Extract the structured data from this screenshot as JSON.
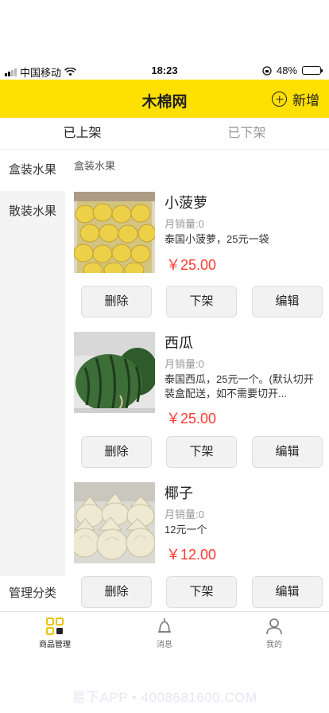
{
  "status_bar": {
    "carrier": "中国移动",
    "time": "18:23",
    "battery": "48%",
    "battery_level": 0.48
  },
  "header": {
    "title": "木棉网",
    "add_label": "新增"
  },
  "tabs": [
    {
      "label": "已上架",
      "active": true
    },
    {
      "label": "已下架",
      "active": false
    }
  ],
  "sidebar": {
    "categories": [
      {
        "label": "盒装水果"
      },
      {
        "label": "散装水果"
      }
    ],
    "manage_label": "管理分类"
  },
  "main": {
    "section_title": "盒装水果"
  },
  "products": [
    {
      "name": "小菠萝",
      "sales": "月销量:0",
      "desc": "泰国小菠萝，25元一袋",
      "price": "￥25.00",
      "actions": [
        "删除",
        "下架",
        "编辑"
      ]
    },
    {
      "name": "西瓜",
      "sales": "月销量:0",
      "desc": "泰国西瓜，25元一个。(默认切开装盒配送，如不需要切开...",
      "price": "￥25.00",
      "actions": [
        "删除",
        "下架",
        "编辑"
      ]
    },
    {
      "name": "椰子",
      "sales": "月销量:0",
      "desc": "12元一个",
      "price": "￥12.00",
      "actions": [
        "删除",
        "下架",
        "编辑"
      ]
    }
  ],
  "tabbar": [
    {
      "label": "商品管理",
      "icon": "grid-icon"
    },
    {
      "label": "消息",
      "icon": "bell-icon"
    },
    {
      "label": "我的",
      "icon": "person-icon"
    }
  ],
  "watermark": "易下APP • 4008681600.COM",
  "colors": {
    "accent": "#ffe000",
    "price": "#ff3b30"
  }
}
